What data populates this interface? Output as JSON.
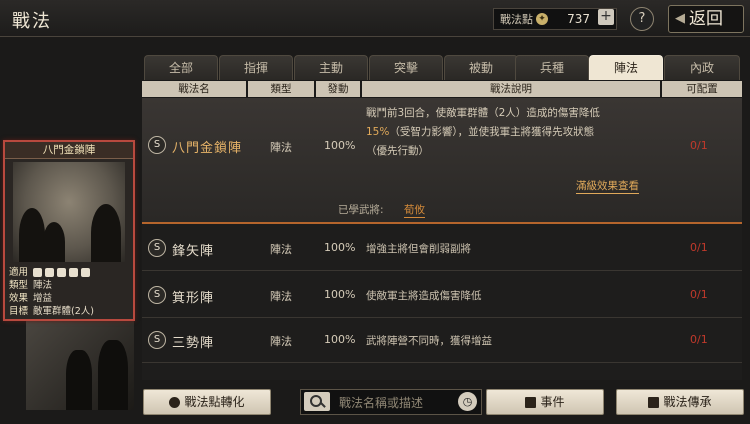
{
  "header": {
    "title": "戰法",
    "points_label": "戰法點",
    "points_value": "737",
    "plus_glyph": "+",
    "help_glyph": "?",
    "back_label": "返回"
  },
  "tabs": [
    "全部",
    "指揮",
    "主動",
    "突擊",
    "被動",
    "兵種",
    "陣法",
    "內政"
  ],
  "active_tab": "陣法",
  "columns": [
    "戰法名",
    "類型",
    "發動",
    "戰法說明",
    "可配置"
  ],
  "card": {
    "title": "八門金鎖陣",
    "rows": [
      {
        "k": "適用",
        "v": ""
      },
      {
        "k": "類型",
        "v": "陣法"
      },
      {
        "k": "效果",
        "v": "增益"
      },
      {
        "k": "目標",
        "v": "敵軍群體(2人)"
      }
    ]
  },
  "selected": {
    "badge": "S",
    "name": "八門金鎖陣",
    "type": "陣法",
    "rate": "100%",
    "desc_1": "戰鬥前3回合，使敵軍群體（2人）造成的傷害降低",
    "desc_2_hl": "15%",
    "desc_2": "（受智力影響），並使我軍主將獲得先攻狀態",
    "desc_3": "（優先行動）",
    "config": "0/1",
    "more_link": "滿級效果查看",
    "learned_label": "已學武將:",
    "learned_name": "荀攸"
  },
  "items": [
    {
      "badge": "S",
      "name": "鋒矢陣",
      "type": "陣法",
      "rate": "100%",
      "desc": "增強主將但會削弱副將",
      "config": "0/1"
    },
    {
      "badge": "S",
      "name": "箕形陣",
      "type": "陣法",
      "rate": "100%",
      "desc": "使敵軍主將造成傷害降低",
      "config": "0/1"
    },
    {
      "badge": "S",
      "name": "三勢陣",
      "type": "陣法",
      "rate": "100%",
      "desc": "武將陣營不同時，獲得增益",
      "config": "0/1"
    }
  ],
  "bottom": {
    "convert_label": "戰法點轉化",
    "search_placeholder": "戰法名稱或描述",
    "event_label": "事件",
    "inherit_label": "戰法傳承"
  },
  "colors": {
    "accent_orange": "#e0a95a",
    "config_red": "#c0392b",
    "active_tab_bg": "#efe6d3"
  }
}
